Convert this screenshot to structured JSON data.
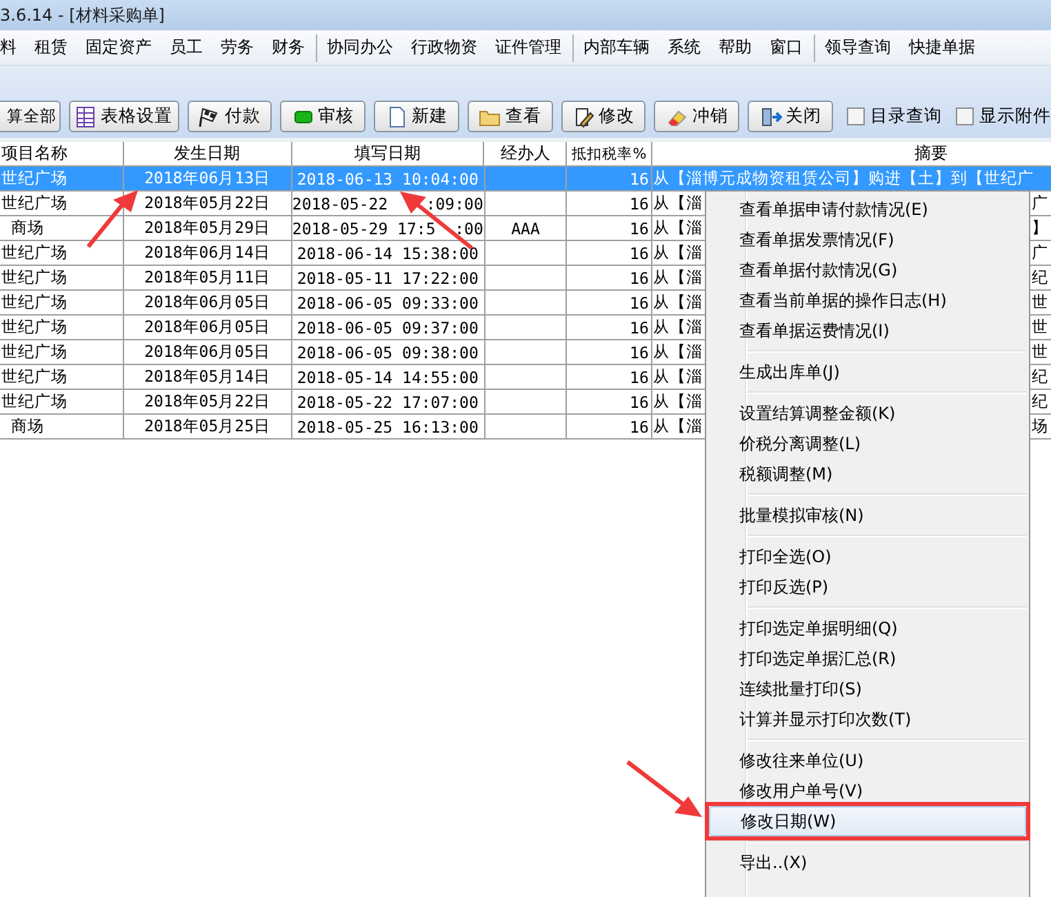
{
  "window": {
    "title": "3.6.14 - [材料采购单]"
  },
  "menu_bar": [
    [
      "料",
      "租赁",
      "固定资产",
      "员工",
      "劳务",
      "财务"
    ],
    [
      "协同办公",
      "行政物资",
      "证件管理"
    ],
    [
      "内部车辆",
      "系统",
      "帮助",
      "窗口"
    ],
    [
      "领导查询",
      "快捷单据"
    ]
  ],
  "toolbar": {
    "buttons": [
      "算全部",
      "表格设置",
      "付款",
      "审核",
      "新建",
      "查看",
      "修改",
      "冲销",
      "关闭"
    ],
    "checkboxes": [
      {
        "label": "目录查询",
        "checked": false
      },
      {
        "label": "显示附件",
        "checked": false
      }
    ]
  },
  "table": {
    "columns": [
      "项目名称",
      "发生日期",
      "填写日期",
      "经办人",
      "抵扣税率%",
      "摘要"
    ],
    "rows": [
      {
        "selected": true,
        "cells": [
          "世纪广场",
          "2018年06月13日",
          "2018-06-13 10:04:00",
          "",
          "16",
          "从【淄博元成物资租赁公司】购进【土】到【世纪广"
        ],
        "summary_tail": ""
      },
      {
        "selected": false,
        "cells": [
          "世纪广场",
          "2018年05月22日",
          "2018-05-22    :09:00",
          "",
          "16",
          "从【淄"
        ],
        "summary_tail": "广"
      },
      {
        "selected": false,
        "cells": [
          "商场",
          "2018年05月29日",
          "2018-05-29 17:5  :00",
          "AAA",
          "16",
          "从【淄"
        ],
        "summary_tail": "】"
      },
      {
        "selected": false,
        "cells": [
          "世纪广场",
          "2018年06月14日",
          "2018-06-14 15:38:00",
          "",
          "16",
          "从【淄"
        ],
        "summary_tail": "广"
      },
      {
        "selected": false,
        "cells": [
          "世纪广场",
          "2018年05月11日",
          "2018-05-11 17:22:00",
          "",
          "16",
          "从【淄"
        ],
        "summary_tail": "纪"
      },
      {
        "selected": false,
        "cells": [
          "世纪广场",
          "2018年06月05日",
          "2018-06-05 09:33:00",
          "",
          "16",
          "从【淄"
        ],
        "summary_tail": "世"
      },
      {
        "selected": false,
        "cells": [
          "世纪广场",
          "2018年06月05日",
          "2018-06-05 09:37:00",
          "",
          "16",
          "从【淄"
        ],
        "summary_tail": "世"
      },
      {
        "selected": false,
        "cells": [
          "世纪广场",
          "2018年06月05日",
          "2018-06-05 09:38:00",
          "",
          "16",
          "从【淄"
        ],
        "summary_tail": "世"
      },
      {
        "selected": false,
        "cells": [
          "世纪广场",
          "2018年05月14日",
          "2018-05-14 14:55:00",
          "",
          "16",
          "从【淄"
        ],
        "summary_tail": "纪"
      },
      {
        "selected": false,
        "cells": [
          "世纪广场",
          "2018年05月22日",
          "2018-05-22 17:07:00",
          "",
          "16",
          "从【淄"
        ],
        "summary_tail": "纪"
      },
      {
        "selected": false,
        "cells": [
          "商场",
          "2018年05月25日",
          "2018-05-25 16:13:00",
          "",
          "16",
          "从【淄"
        ],
        "summary_tail": "场"
      }
    ]
  },
  "context_menu": {
    "groups": [
      [
        {
          "label": "查看单据申请付款情况(E)",
          "selected": false
        },
        {
          "label": "查看单据发票情况(F)",
          "selected": false
        },
        {
          "label": "查看单据付款情况(G)",
          "selected": false
        },
        {
          "label": "查看当前单据的操作日志(H)",
          "selected": false
        },
        {
          "label": "查看单据运费情况(I)",
          "selected": false
        }
      ],
      [
        {
          "label": "生成出库单(J)",
          "selected": false
        }
      ],
      [
        {
          "label": "设置结算调整金额(K)",
          "selected": false
        },
        {
          "label": "价税分离调整(L)",
          "selected": false
        },
        {
          "label": "税额调整(M)",
          "selected": false
        }
      ],
      [
        {
          "label": "批量模拟审核(N)",
          "selected": false
        }
      ],
      [
        {
          "label": "打印全选(O)",
          "selected": false
        },
        {
          "label": "打印反选(P)",
          "selected": false
        }
      ],
      [
        {
          "label": "打印选定单据明细(Q)",
          "selected": false
        },
        {
          "label": "打印选定单据汇总(R)",
          "selected": false
        },
        {
          "label": "连续批量打印(S)",
          "selected": false
        },
        {
          "label": "计算并显示打印次数(T)",
          "selected": false
        }
      ],
      [
        {
          "label": "修改往来单位(U)",
          "selected": false
        },
        {
          "label": "修改用户单号(V)",
          "selected": false
        },
        {
          "label": "修改日期(W)",
          "selected": true
        }
      ],
      [
        {
          "label": "导出..(X)",
          "selected": false
        }
      ]
    ]
  }
}
